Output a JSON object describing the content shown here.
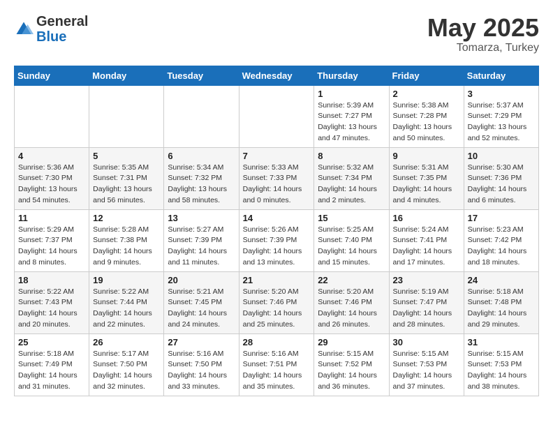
{
  "header": {
    "logo_general": "General",
    "logo_blue": "Blue",
    "month": "May 2025",
    "location": "Tomarza, Turkey"
  },
  "weekdays": [
    "Sunday",
    "Monday",
    "Tuesday",
    "Wednesday",
    "Thursday",
    "Friday",
    "Saturday"
  ],
  "weeks": [
    [
      {
        "day": "",
        "info": ""
      },
      {
        "day": "",
        "info": ""
      },
      {
        "day": "",
        "info": ""
      },
      {
        "day": "",
        "info": ""
      },
      {
        "day": "1",
        "info": "Sunrise: 5:39 AM\nSunset: 7:27 PM\nDaylight: 13 hours\nand 47 minutes."
      },
      {
        "day": "2",
        "info": "Sunrise: 5:38 AM\nSunset: 7:28 PM\nDaylight: 13 hours\nand 50 minutes."
      },
      {
        "day": "3",
        "info": "Sunrise: 5:37 AM\nSunset: 7:29 PM\nDaylight: 13 hours\nand 52 minutes."
      }
    ],
    [
      {
        "day": "4",
        "info": "Sunrise: 5:36 AM\nSunset: 7:30 PM\nDaylight: 13 hours\nand 54 minutes."
      },
      {
        "day": "5",
        "info": "Sunrise: 5:35 AM\nSunset: 7:31 PM\nDaylight: 13 hours\nand 56 minutes."
      },
      {
        "day": "6",
        "info": "Sunrise: 5:34 AM\nSunset: 7:32 PM\nDaylight: 13 hours\nand 58 minutes."
      },
      {
        "day": "7",
        "info": "Sunrise: 5:33 AM\nSunset: 7:33 PM\nDaylight: 14 hours\nand 0 minutes."
      },
      {
        "day": "8",
        "info": "Sunrise: 5:32 AM\nSunset: 7:34 PM\nDaylight: 14 hours\nand 2 minutes."
      },
      {
        "day": "9",
        "info": "Sunrise: 5:31 AM\nSunset: 7:35 PM\nDaylight: 14 hours\nand 4 minutes."
      },
      {
        "day": "10",
        "info": "Sunrise: 5:30 AM\nSunset: 7:36 PM\nDaylight: 14 hours\nand 6 minutes."
      }
    ],
    [
      {
        "day": "11",
        "info": "Sunrise: 5:29 AM\nSunset: 7:37 PM\nDaylight: 14 hours\nand 8 minutes."
      },
      {
        "day": "12",
        "info": "Sunrise: 5:28 AM\nSunset: 7:38 PM\nDaylight: 14 hours\nand 9 minutes."
      },
      {
        "day": "13",
        "info": "Sunrise: 5:27 AM\nSunset: 7:39 PM\nDaylight: 14 hours\nand 11 minutes."
      },
      {
        "day": "14",
        "info": "Sunrise: 5:26 AM\nSunset: 7:39 PM\nDaylight: 14 hours\nand 13 minutes."
      },
      {
        "day": "15",
        "info": "Sunrise: 5:25 AM\nSunset: 7:40 PM\nDaylight: 14 hours\nand 15 minutes."
      },
      {
        "day": "16",
        "info": "Sunrise: 5:24 AM\nSunset: 7:41 PM\nDaylight: 14 hours\nand 17 minutes."
      },
      {
        "day": "17",
        "info": "Sunrise: 5:23 AM\nSunset: 7:42 PM\nDaylight: 14 hours\nand 18 minutes."
      }
    ],
    [
      {
        "day": "18",
        "info": "Sunrise: 5:22 AM\nSunset: 7:43 PM\nDaylight: 14 hours\nand 20 minutes."
      },
      {
        "day": "19",
        "info": "Sunrise: 5:22 AM\nSunset: 7:44 PM\nDaylight: 14 hours\nand 22 minutes."
      },
      {
        "day": "20",
        "info": "Sunrise: 5:21 AM\nSunset: 7:45 PM\nDaylight: 14 hours\nand 24 minutes."
      },
      {
        "day": "21",
        "info": "Sunrise: 5:20 AM\nSunset: 7:46 PM\nDaylight: 14 hours\nand 25 minutes."
      },
      {
        "day": "22",
        "info": "Sunrise: 5:20 AM\nSunset: 7:46 PM\nDaylight: 14 hours\nand 26 minutes."
      },
      {
        "day": "23",
        "info": "Sunrise: 5:19 AM\nSunset: 7:47 PM\nDaylight: 14 hours\nand 28 minutes."
      },
      {
        "day": "24",
        "info": "Sunrise: 5:18 AM\nSunset: 7:48 PM\nDaylight: 14 hours\nand 29 minutes."
      }
    ],
    [
      {
        "day": "25",
        "info": "Sunrise: 5:18 AM\nSunset: 7:49 PM\nDaylight: 14 hours\nand 31 minutes."
      },
      {
        "day": "26",
        "info": "Sunrise: 5:17 AM\nSunset: 7:50 PM\nDaylight: 14 hours\nand 32 minutes."
      },
      {
        "day": "27",
        "info": "Sunrise: 5:16 AM\nSunset: 7:50 PM\nDaylight: 14 hours\nand 33 minutes."
      },
      {
        "day": "28",
        "info": "Sunrise: 5:16 AM\nSunset: 7:51 PM\nDaylight: 14 hours\nand 35 minutes."
      },
      {
        "day": "29",
        "info": "Sunrise: 5:15 AM\nSunset: 7:52 PM\nDaylight: 14 hours\nand 36 minutes."
      },
      {
        "day": "30",
        "info": "Sunrise: 5:15 AM\nSunset: 7:53 PM\nDaylight: 14 hours\nand 37 minutes."
      },
      {
        "day": "31",
        "info": "Sunrise: 5:15 AM\nSunset: 7:53 PM\nDaylight: 14 hours\nand 38 minutes."
      }
    ]
  ]
}
